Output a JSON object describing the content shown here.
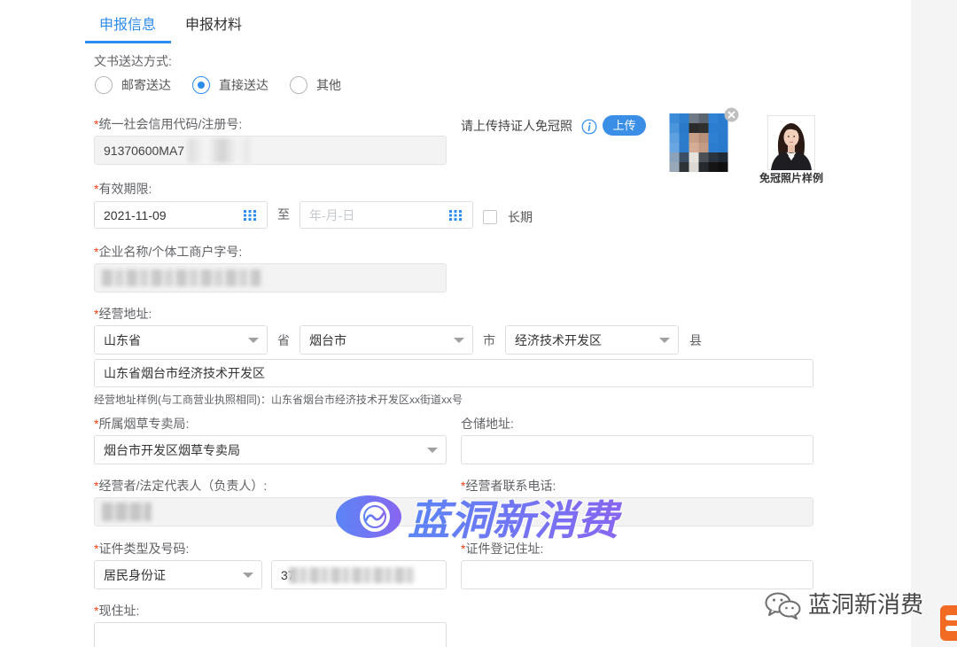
{
  "required_mark": "*",
  "tabs": [
    {
      "label": "申报信息",
      "active": true
    },
    {
      "label": "申报材料",
      "active": false
    }
  ],
  "delivery": {
    "label": "文书送达方式:",
    "options": [
      {
        "label": "邮寄送达",
        "checked": false
      },
      {
        "label": "直接送达",
        "checked": true
      },
      {
        "label": "其他",
        "checked": false
      }
    ]
  },
  "credit_code": {
    "label": "统一社会信用代码/注册号:",
    "value": "91370600MA7"
  },
  "photo_upload": {
    "label": "请上传持证人免冠照",
    "button": "上传",
    "sample_caption": "免冠照片样例"
  },
  "validity": {
    "label": "有效期限:",
    "start": "2021-11-09",
    "separator": "至",
    "end_placeholder": "年-月-日",
    "long_term_label": "长期",
    "long_term_checked": false
  },
  "company_name": {
    "label": "企业名称/个体工商户字号:"
  },
  "business_address": {
    "label": "经营地址:",
    "province": "山东省",
    "province_unit": "省",
    "city": "烟台市",
    "city_unit": "市",
    "district": "经济技术开发区",
    "district_unit": "县",
    "detail": "山东省烟台市经济技术开发区",
    "example": "经营地址样例(与工商营业执照相同)：山东省烟台市经济技术开发区xx街道xx号"
  },
  "tobacco_bureau": {
    "label": "所属烟草专卖局:",
    "value": "烟台市开发区烟草专卖局"
  },
  "warehouse_address": {
    "label": "仓储地址:"
  },
  "operator": {
    "label": "经营者/法定代表人（负责人）:"
  },
  "operator_phone": {
    "label": "经营者联系电话:"
  },
  "id_document": {
    "label": "证件类型及号码:",
    "type": "居民身份证",
    "number": "37"
  },
  "id_address": {
    "label": "证件登记住址:"
  },
  "current_address": {
    "label": "现住址:"
  },
  "watermarks": {
    "center": "蓝洞新消费",
    "corner": "蓝洞新消费"
  },
  "colors": {
    "accent": "#2d8cf0",
    "required": "#ed4014",
    "upload_button": "#3a8ee6"
  }
}
